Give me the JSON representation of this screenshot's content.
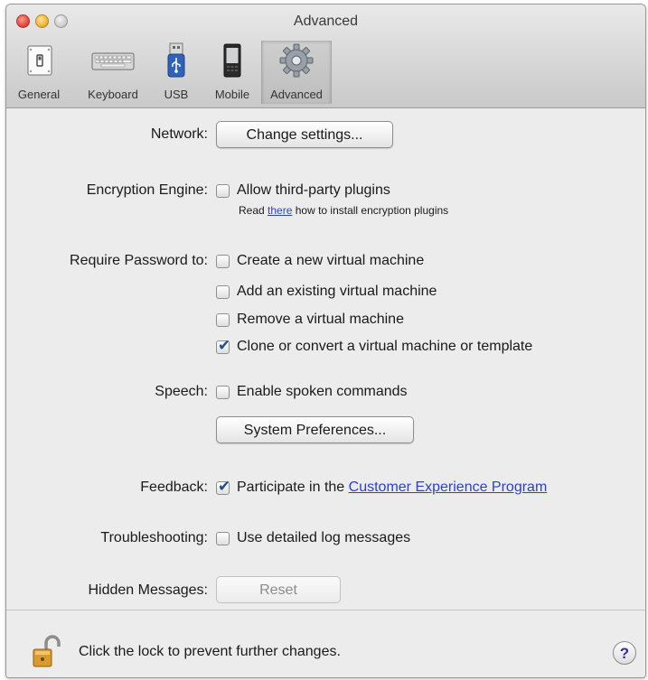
{
  "window": {
    "title": "Advanced"
  },
  "toolbar": {
    "items": [
      {
        "label": "General",
        "icon": "general-switch-icon"
      },
      {
        "label": "Keyboard",
        "icon": "keyboard-icon"
      },
      {
        "label": "USB",
        "icon": "usb-icon"
      },
      {
        "label": "Mobile",
        "icon": "mobile-phone-icon"
      },
      {
        "label": "Advanced",
        "icon": "gear-icon",
        "selected": true
      }
    ]
  },
  "network": {
    "label": "Network:",
    "button": "Change settings..."
  },
  "encryption": {
    "label": "Encryption Engine:",
    "checkbox": "Allow third-party plugins",
    "checked": false,
    "note_prefix": "Read ",
    "note_link": "there",
    "note_suffix": " how to install encryption plugins"
  },
  "require_password": {
    "label": "Require Password to:",
    "options": [
      {
        "label": "Create a new virtual machine",
        "checked": false
      },
      {
        "label": "Add an existing virtual machine",
        "checked": false
      },
      {
        "label": "Remove a virtual machine",
        "checked": false
      },
      {
        "label": "Clone or convert a virtual machine or template",
        "checked": true
      }
    ]
  },
  "speech": {
    "label": "Speech:",
    "checkbox": "Enable spoken commands",
    "checked": false,
    "button": "System Preferences..."
  },
  "feedback": {
    "label": "Feedback:",
    "prefix": "Participate in the ",
    "link": "Customer Experience Program",
    "checked": true
  },
  "troubleshooting": {
    "label": "Troubleshooting:",
    "checkbox": "Use detailed log messages",
    "checked": false
  },
  "hidden_messages": {
    "label": "Hidden Messages:",
    "button": "Reset"
  },
  "footer": {
    "lock_text": "Click the lock to prevent further changes.",
    "help": "?"
  },
  "colors": {
    "link": "#2a3fd0",
    "checkmark": "#1c4f8e",
    "window_bg": "#ececec"
  }
}
